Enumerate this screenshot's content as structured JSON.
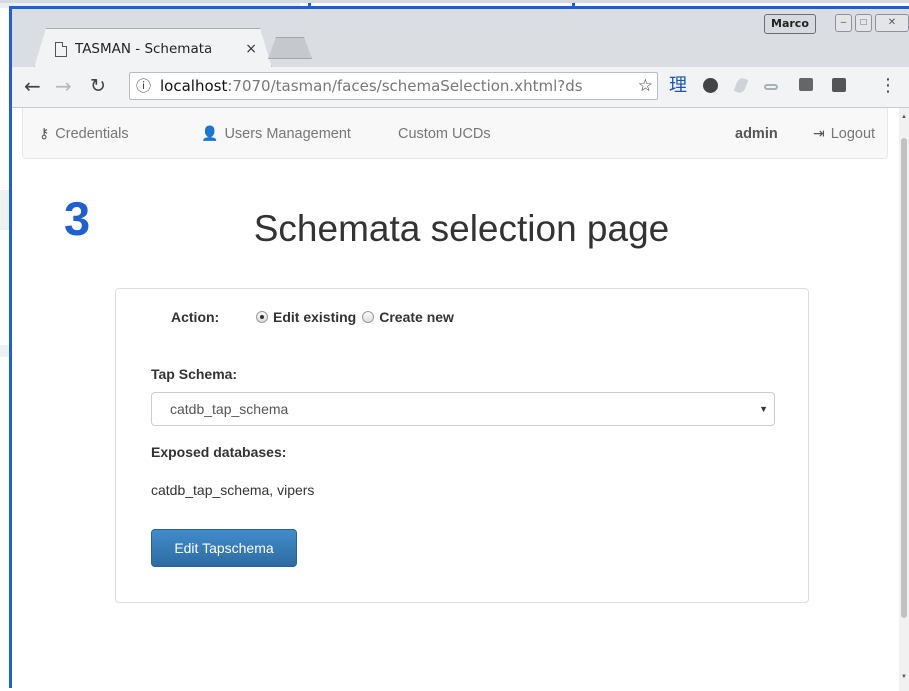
{
  "overlay_step_number": "3",
  "browser": {
    "tab_title": "TASMAN - Schemata",
    "tab_close": "×",
    "profile_name": "Marco",
    "url_host": "localhost",
    "url_rest": ":7070/tasman/faces/schemaSelection.xhtml?ds",
    "ext_badge": "理"
  },
  "navbar": {
    "credentials": "Credentials",
    "users_management": "Users Management",
    "custom_ucds": "Custom UCDs",
    "user": "admin",
    "logout": "Logout"
  },
  "page": {
    "title": "Schemata selection page"
  },
  "form": {
    "action_label": "Action:",
    "action_options": [
      "Edit existing",
      "Create new"
    ],
    "action_selected": "Edit existing",
    "tap_schema_label": "Tap Schema:",
    "tap_schema_value": "catdb_tap_schema",
    "exposed_label": "Exposed databases:",
    "exposed_value": "catdb_tap_schema, vipers",
    "submit_label": "Edit Tapschema"
  },
  "colors": {
    "accent_blue": "#1f5fd1",
    "primary_button": "#337ab7"
  }
}
